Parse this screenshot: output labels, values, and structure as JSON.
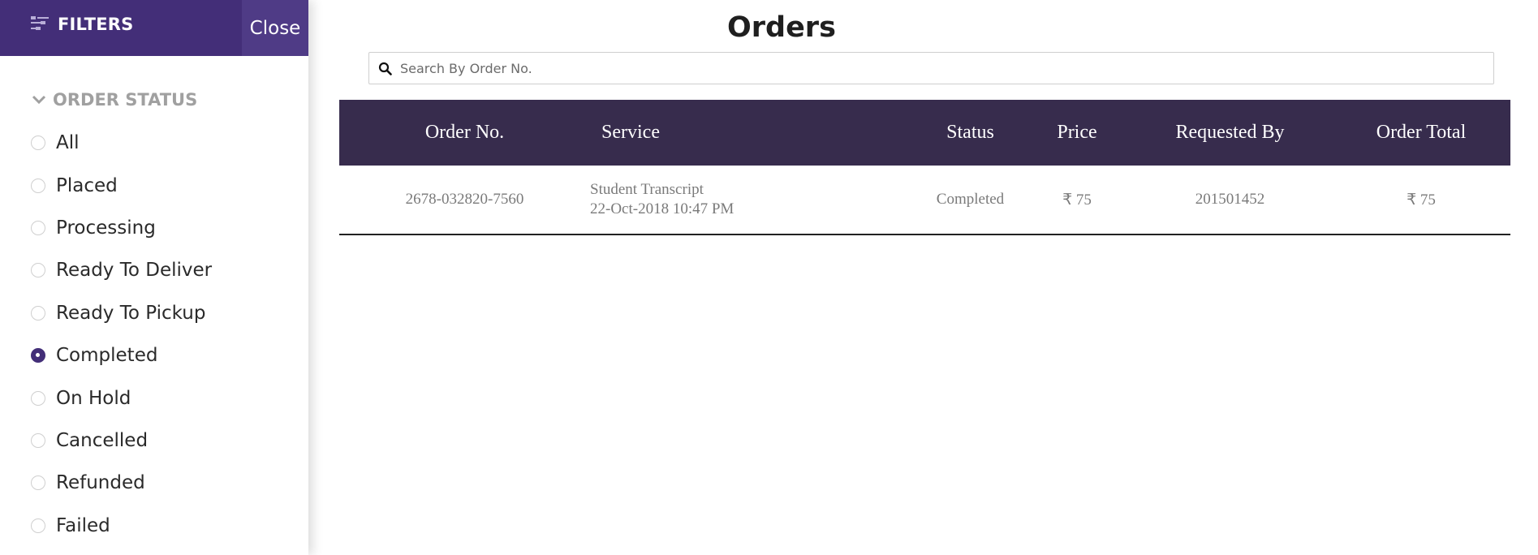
{
  "sidebar": {
    "title": "FILTERS",
    "close_label": "Close",
    "section_heading": "ORDER STATUS",
    "status_options": [
      {
        "label": "All",
        "checked": false
      },
      {
        "label": "Placed",
        "checked": false
      },
      {
        "label": "Processing",
        "checked": false
      },
      {
        "label": "Ready To Deliver",
        "checked": false
      },
      {
        "label": "Ready To Pickup",
        "checked": false
      },
      {
        "label": "Completed",
        "checked": true
      },
      {
        "label": "On Hold",
        "checked": false
      },
      {
        "label": "Cancelled",
        "checked": false
      },
      {
        "label": "Refunded",
        "checked": false
      },
      {
        "label": "Failed",
        "checked": false
      }
    ]
  },
  "main": {
    "title": "Orders",
    "search": {
      "placeholder": "Search By Order No.",
      "value": ""
    },
    "table": {
      "columns": [
        "Order No.",
        "Service",
        "Status",
        "Price",
        "Requested By",
        "Order Total"
      ],
      "rows": [
        {
          "order_no": "2678-032820-7560",
          "service_name": "Student Transcript",
          "service_date": "22-Oct-2018 10:47 PM",
          "status": "Completed",
          "price": "₹ 75",
          "requested_by": "201501452",
          "order_total": "₹ 75"
        }
      ]
    }
  },
  "colors": {
    "header_purple": "#432e78",
    "close_button_purple": "#4f3b86",
    "table_header": "#372c4d",
    "radio_checked": "#432e78"
  },
  "icons": {
    "filters": "filters-icon",
    "chevron": "chevron-down-icon",
    "search": "search-icon"
  }
}
